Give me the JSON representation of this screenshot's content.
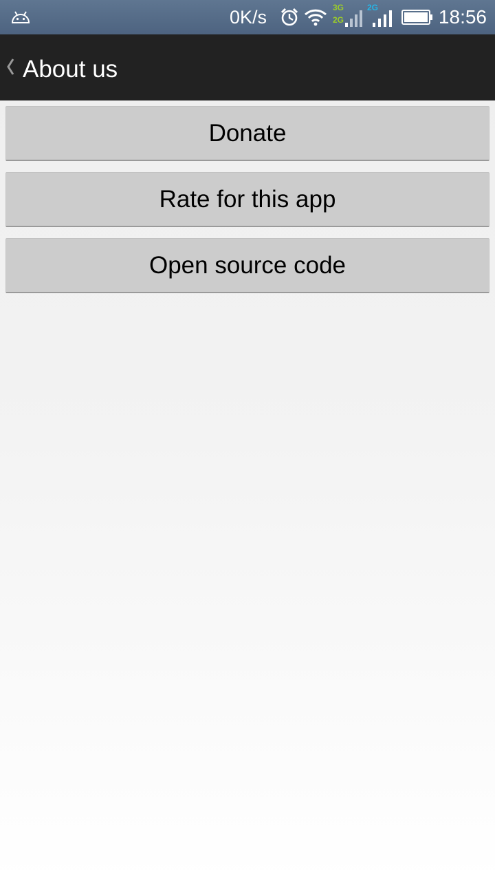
{
  "status_bar": {
    "speed": "0K/s",
    "time": "18:56",
    "sim1": {
      "top": "3G",
      "bottom": "2G"
    },
    "sim2": {
      "top": "2G"
    },
    "colors": {
      "sim1_net": "#9ccc2a",
      "sim2_net": "#25b6e8"
    }
  },
  "action_bar": {
    "title": "About us"
  },
  "buttons": {
    "donate": "Donate",
    "rate": "Rate for this app",
    "source": "Open source code"
  }
}
